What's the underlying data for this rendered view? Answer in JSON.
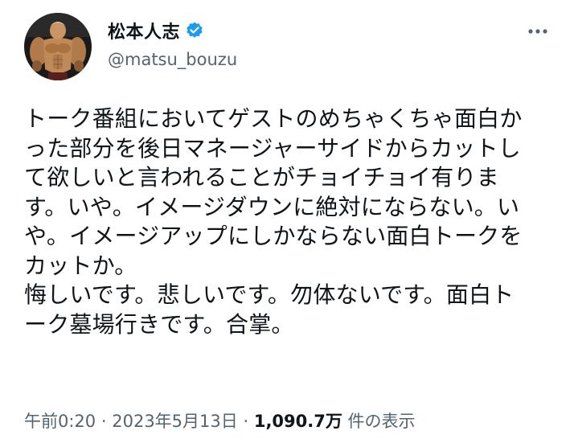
{
  "user": {
    "display_name": "松本人志",
    "handle": "@matsu_bouzu",
    "verified": true,
    "avatar_icon": "bodybuilder-figure-avatar"
  },
  "tweet": {
    "text": "トーク番組においてゲストのめちゃくちゃ面白か\nった部分を後日マネージャーサイドからカットし\nて欲しいと言われることがチョイチョイ有りま\nす。いや。イメージダウンに絶対にならない。い\nや。イメージアップにしかならない面白トークを\nカットか。\n悔しいです。悲しいです。勿体ないです。面白ト\nーク墓場行きです。合掌。"
  },
  "meta": {
    "time": "午前0:20",
    "separator": "·",
    "date": "2023年5月13日",
    "views_count": "1,090.7万",
    "views_label": "件の表示"
  },
  "colors": {
    "text_primary": "#0f1419",
    "text_secondary": "#536471",
    "verified_blue": "#1d9bf0"
  },
  "icons": {
    "verified": "verified-badge-icon",
    "more": "more-options-icon"
  }
}
